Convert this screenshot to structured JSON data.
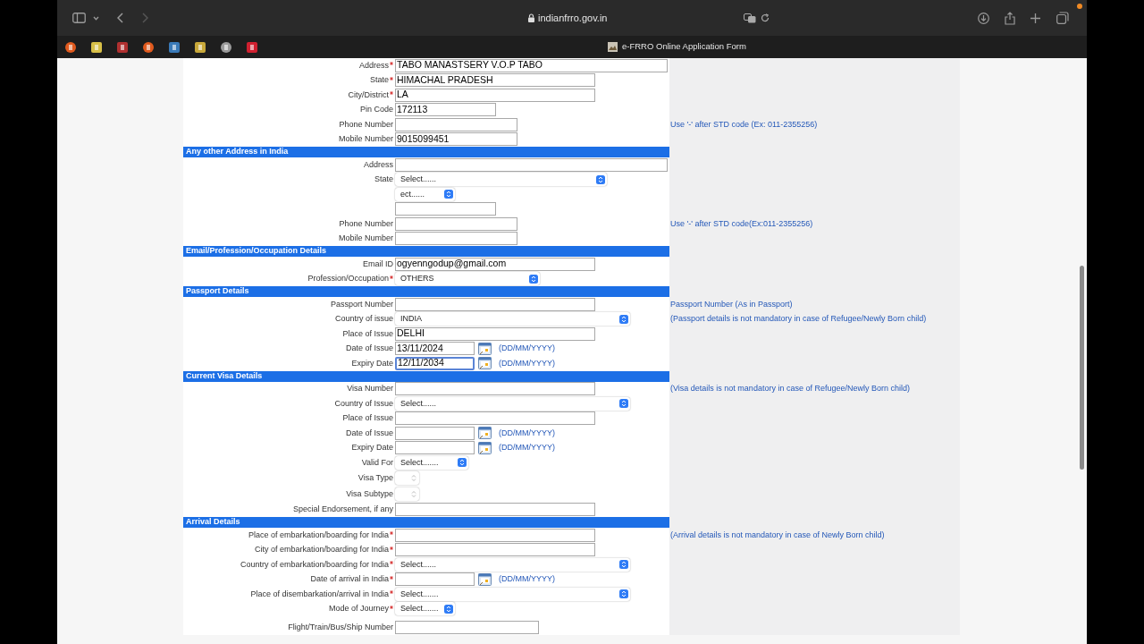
{
  "browser": {
    "url": "indianfrro.gov.in",
    "tab_title": "e-FRRO Online Application Form"
  },
  "form": {
    "rows": [
      {
        "kind": "long-field",
        "label": "Address",
        "required": true,
        "focused": false,
        "value": "TABO MANASTSERY V.O.P TABO"
      },
      {
        "kind": "field",
        "label": "State",
        "required": true,
        "focused": false,
        "value": "HIMACHAL PRADESH"
      },
      {
        "kind": "field",
        "label": "City/District",
        "required": true,
        "focused": false,
        "value": "LA"
      },
      {
        "kind": "pin-field",
        "label": "Pin Code",
        "required": false,
        "focused": false,
        "value": "172113"
      },
      {
        "kind": "phone-field",
        "label": "Phone Number",
        "required": false,
        "focused": false,
        "hint": "Use '-' after STD code (Ex: 011-2355256)"
      },
      {
        "kind": "phone-field",
        "label": "Mobile Number",
        "required": false,
        "focused": false,
        "value": "9015099451"
      },
      {
        "kind": "header",
        "title": "Any other Address in India"
      },
      {
        "kind": "long-field",
        "label": "Address",
        "required": false,
        "focused": false
      },
      {
        "kind": "select-l",
        "label": "State",
        "required": false,
        "focused": false,
        "value": "Select......"
      },
      {
        "kind": "select-xs",
        "required": false,
        "focused": false,
        "value": "ect......"
      },
      {
        "kind": "pin-field",
        "required": false,
        "focused": false
      },
      {
        "kind": "phone-field",
        "label": "Phone Number",
        "required": false,
        "focused": false,
        "hint": "Use '-' after STD code(Ex:011-2355256)"
      },
      {
        "kind": "phone-field",
        "label": "Mobile Number",
        "required": false,
        "focused": false
      },
      {
        "kind": "header",
        "title": "Email/Profession/Occupation Details"
      },
      {
        "kind": "field",
        "label": "Email ID",
        "required": false,
        "focused": false,
        "value": "ogyenngodup@gmail.com"
      },
      {
        "kind": "select-m",
        "label": "Profession/Occupation",
        "required": true,
        "focused": false,
        "value": "OTHERS"
      },
      {
        "kind": "header",
        "title": "Passport Details"
      },
      {
        "kind": "field",
        "label": "Passport Number",
        "required": false,
        "focused": false,
        "hint": "Passport Number (As in Passport)"
      },
      {
        "kind": "select-xl",
        "label": "Country of issue",
        "required": false,
        "focused": false,
        "value": "INDIA",
        "hint": "(Passport details is not mandatory in case of Refugee/Newly Born child)"
      },
      {
        "kind": "field",
        "label": "Place of Issue",
        "required": false,
        "focused": false,
        "value": "DELHI"
      },
      {
        "kind": "date-field",
        "label": "Date of Issue",
        "required": false,
        "focused": false,
        "value": "13/11/2024",
        "format": "(DD/MM/YYYY)"
      },
      {
        "kind": "date-field",
        "label": "Expiry Date",
        "required": false,
        "focused": true,
        "value": "12/11/2034",
        "format": "(DD/MM/YYYY)"
      },
      {
        "kind": "header",
        "title": "Current Visa Details"
      },
      {
        "kind": "field",
        "label": "Visa Number",
        "required": false,
        "focused": false,
        "hint": "(Visa details is not mandatory in case of Refugee/Newly Born child)"
      },
      {
        "kind": "select-xl",
        "label": "Country of Issue",
        "required": false,
        "focused": false,
        "value": "Select......"
      },
      {
        "kind": "field",
        "label": "Place of Issue",
        "required": false,
        "focused": false
      },
      {
        "kind": "date-field",
        "label": "Date of Issue",
        "required": false,
        "focused": false,
        "format": "(DD/MM/YYYY)"
      },
      {
        "kind": "date-field",
        "label": "Expiry Date",
        "required": false,
        "focused": false,
        "format": "(DD/MM/YYYY)"
      },
      {
        "kind": "select-s",
        "label": "Valid For",
        "required": false,
        "focused": false,
        "value": "Select......."
      },
      {
        "kind": "select-tiny",
        "label": "Visa Type",
        "required": false,
        "focused": false
      },
      {
        "kind": "select-tiny",
        "label": "Visa Subtype",
        "required": false,
        "focused": false
      },
      {
        "kind": "field",
        "label": "Special Endorsement, if any",
        "required": false,
        "focused": false
      },
      {
        "kind": "header",
        "title": "Arrival Details"
      },
      {
        "kind": "field",
        "label": "Place of embarkation/boarding for India",
        "required": true,
        "focused": false,
        "hint": "(Arrival details is not mandatory in case of Newly Born child)"
      },
      {
        "kind": "field",
        "label": "City of embarkation/boarding for India",
        "required": true,
        "focused": false
      },
      {
        "kind": "select-xl",
        "label": "Country of embarkation/boarding for India",
        "required": true,
        "focused": false,
        "value": "Select......"
      },
      {
        "kind": "date-field",
        "label": "Date of arrival in India",
        "required": true,
        "focused": false,
        "format": "(DD/MM/YYYY)"
      },
      {
        "kind": "select-xl",
        "label": "Place of disembarkation/arrival in India",
        "required": true,
        "focused": false,
        "value": "Select......."
      },
      {
        "kind": "select-xs",
        "label": "Mode of Journey",
        "required": true,
        "focused": false,
        "value": "Select......."
      },
      {
        "kind": "number-field",
        "label": "Flight/Train/Bus/Ship Number",
        "required": false,
        "focused": false
      }
    ]
  }
}
